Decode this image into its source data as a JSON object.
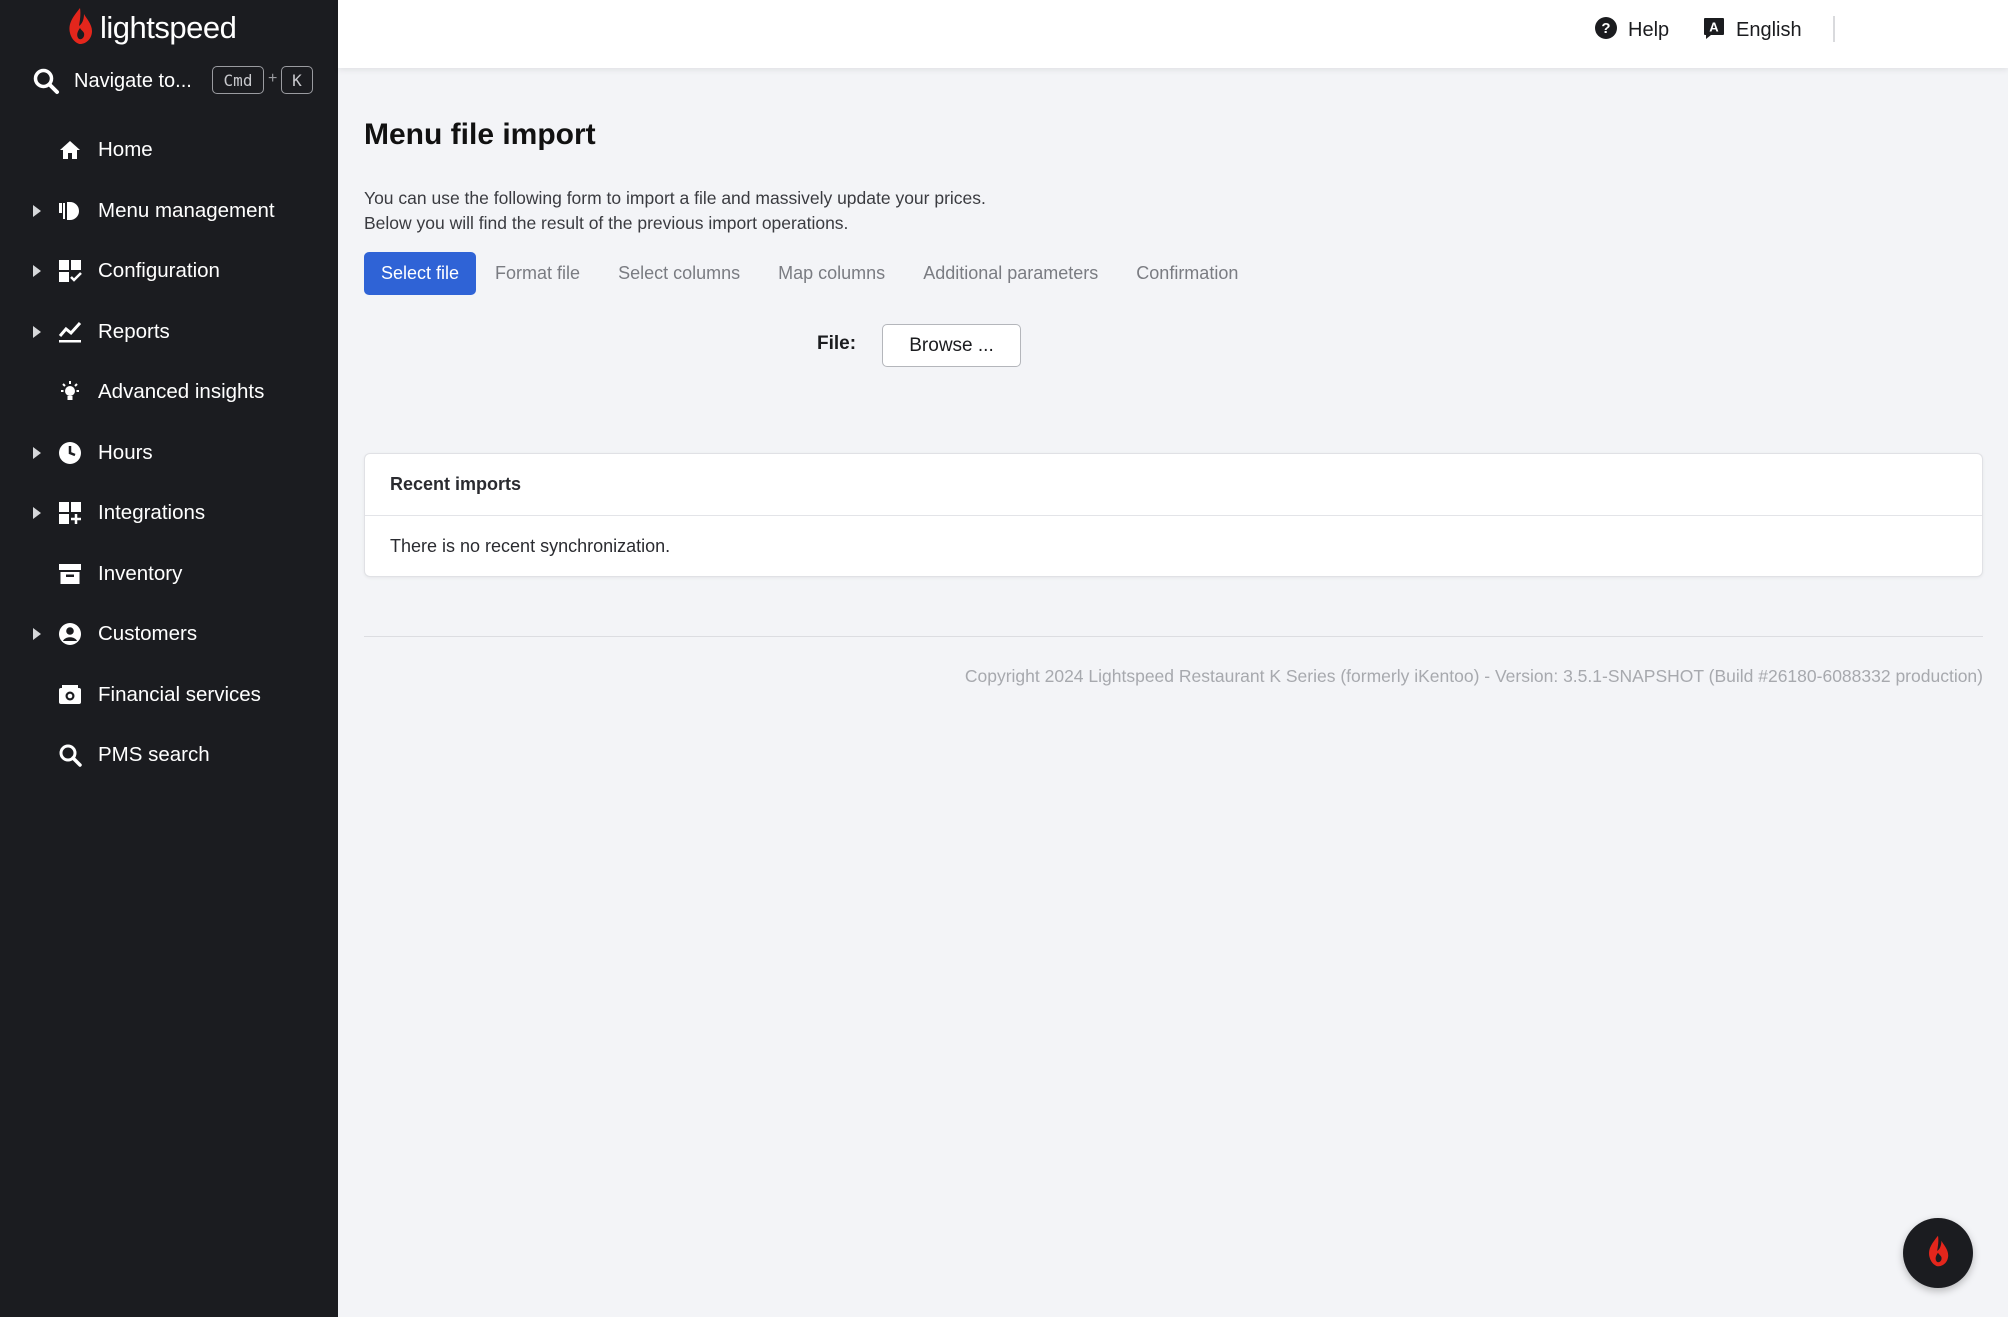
{
  "app": {
    "logo_text": "lightspeed",
    "brand_color": "#e4261c",
    "accent_color": "#2f63d6"
  },
  "sidebar": {
    "search": {
      "label": "Navigate to...",
      "kbd_cmd": "Cmd",
      "kbd_plus": "+",
      "kbd_key": "K"
    },
    "items": [
      {
        "label": "Home",
        "icon": "home-icon",
        "expandable": false
      },
      {
        "label": "Menu management",
        "icon": "menu-icon",
        "expandable": true
      },
      {
        "label": "Configuration",
        "icon": "configuration-icon",
        "expandable": true
      },
      {
        "label": "Reports",
        "icon": "reports-icon",
        "expandable": true
      },
      {
        "label": "Advanced insights",
        "icon": "lightbulb-icon",
        "expandable": false
      },
      {
        "label": "Hours",
        "icon": "clock-icon",
        "expandable": true
      },
      {
        "label": "Integrations",
        "icon": "integrations-icon",
        "expandable": true
      },
      {
        "label": "Inventory",
        "icon": "inventory-icon",
        "expandable": false
      },
      {
        "label": "Customers",
        "icon": "customer-icon",
        "expandable": true
      },
      {
        "label": "Financial services",
        "icon": "camera-icon",
        "expandable": false
      },
      {
        "label": "PMS search",
        "icon": "search-icon",
        "expandable": false
      }
    ]
  },
  "header": {
    "help_label": "Help",
    "language_label": "English"
  },
  "main": {
    "title": "Menu file import",
    "description_line1": "You can use the following form to import a file and massively update your prices.",
    "description_line2": "Below you will find the result of the previous import operations.",
    "steps": [
      {
        "label": "Select file",
        "active": true
      },
      {
        "label": "Format file",
        "active": false
      },
      {
        "label": "Select columns",
        "active": false
      },
      {
        "label": "Map columns",
        "active": false
      },
      {
        "label": "Additional parameters",
        "active": false
      },
      {
        "label": "Confirmation",
        "active": false
      }
    ],
    "file_label": "File:",
    "browse_label": "Browse ...",
    "recent": {
      "title": "Recent imports",
      "empty_text": "There is no recent synchronization."
    },
    "copyright": "Copyright 2024 Lightspeed Restaurant K Series (formerly iKentoo) - Version: 3.5.1-SNAPSHOT (Build #26180-6088332 production)"
  }
}
